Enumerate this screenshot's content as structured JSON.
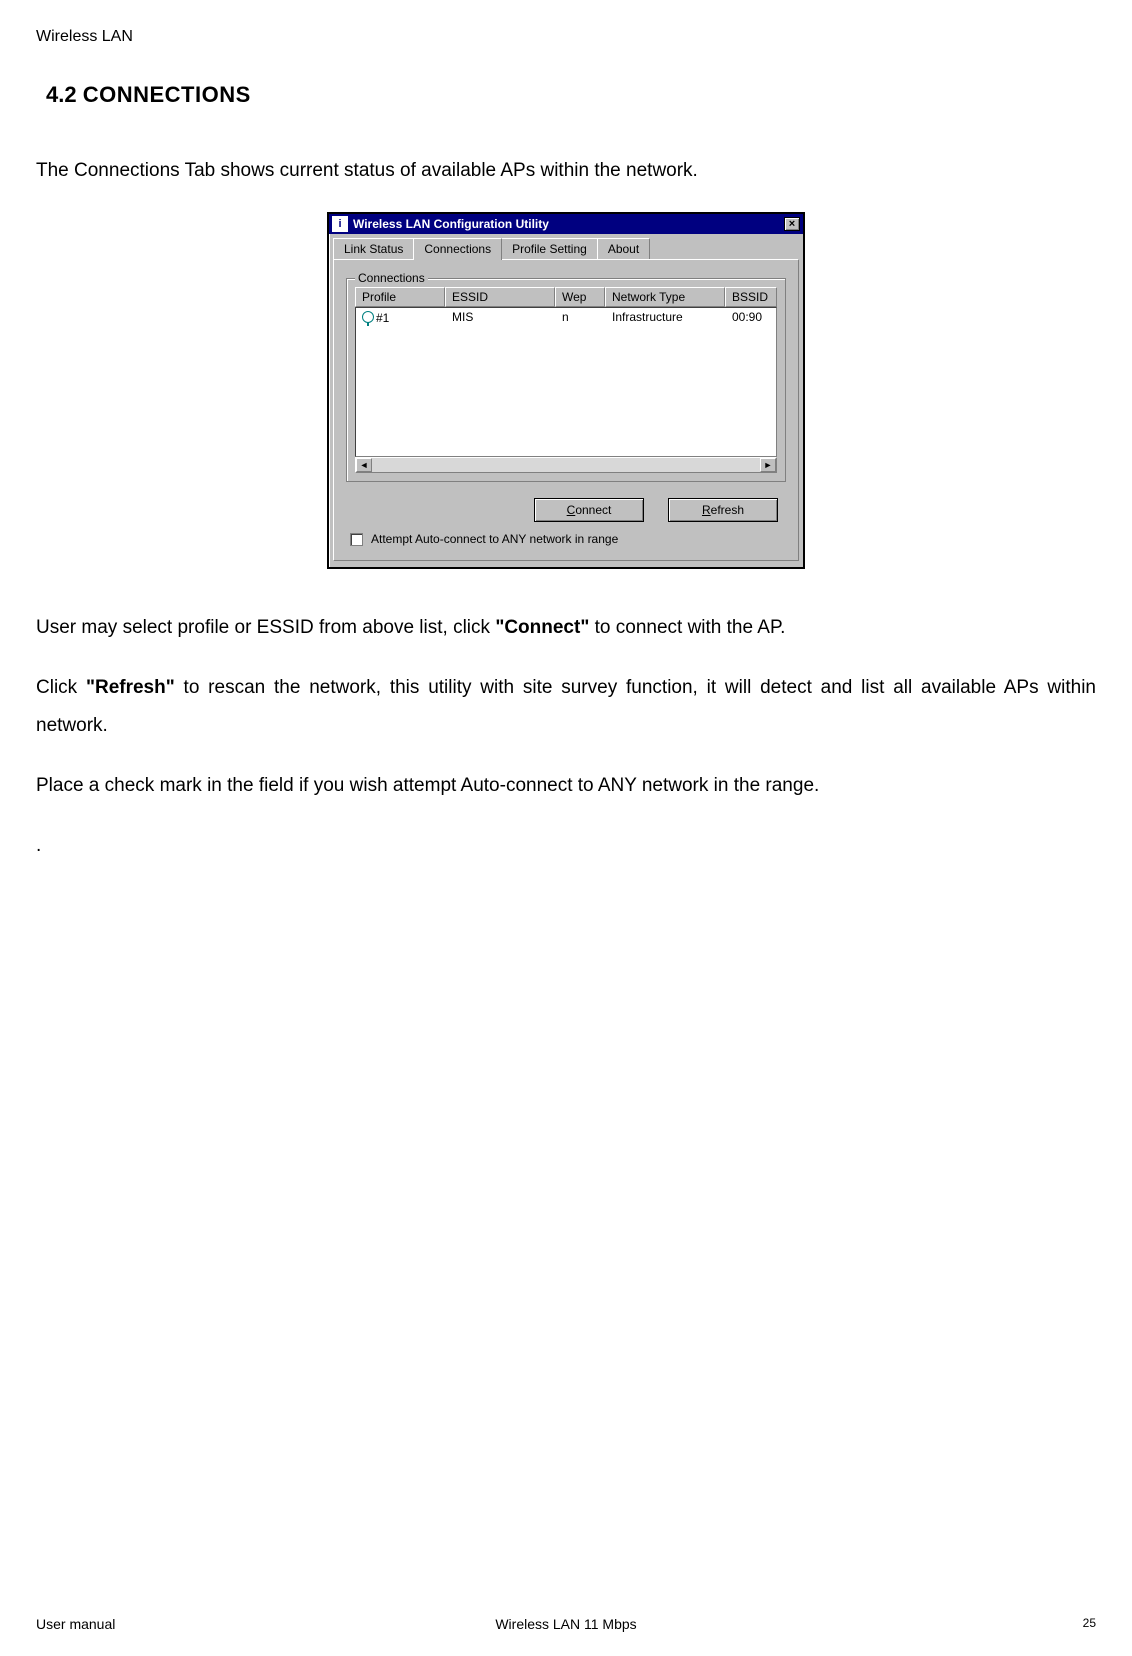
{
  "page": {
    "header_label": "Wireless LAN",
    "section_number": "4.2",
    "section_word": "CONNECTIONS",
    "intro": "The Connections Tab shows  current status of available APs within the network.",
    "para_sel_pre": "User may select profile or ESSID from above list, click ",
    "para_sel_bold": "\"Connect\"",
    "para_sel_post": " to connect with the AP.",
    "para_ref_pre": "Click ",
    "para_ref_bold": "\"Refresh\"",
    "para_ref_post": " to rescan the network, this utility with site survey function, it will detect and list all available APs within network.",
    "para_auto": "Place a check mark in the field if you wish attempt Auto-connect to ANY network in the range.",
    "dot": "."
  },
  "dialog": {
    "title": "Wireless LAN Configuration Utility",
    "close_glyph": "×",
    "tabs": {
      "link": "Link Status",
      "conn": "Connections",
      "prof": "Profile Setting",
      "about": "About"
    },
    "group_label": "Connections",
    "headers": {
      "profile": "Profile",
      "essid": "ESSID",
      "wep": "Wep",
      "nettype": "Network Type",
      "bssid": "BSSID"
    },
    "row": {
      "profile": "#1",
      "essid": "MIS",
      "wep": "n",
      "nettype": "Infrastructure",
      "bssid": "00:90"
    },
    "scroll_left": "◄",
    "scroll_right": "►",
    "btn_connect_pre": "",
    "btn_connect_u": "C",
    "btn_connect_post": "onnect",
    "btn_refresh_pre": "",
    "btn_refresh_u": "R",
    "btn_refresh_post": "efresh",
    "checkbox_label": "Attempt Auto-connect to ANY network in range"
  },
  "footer": {
    "left": "User manual",
    "center": "Wireless LAN 11 Mbps",
    "right": "25"
  }
}
